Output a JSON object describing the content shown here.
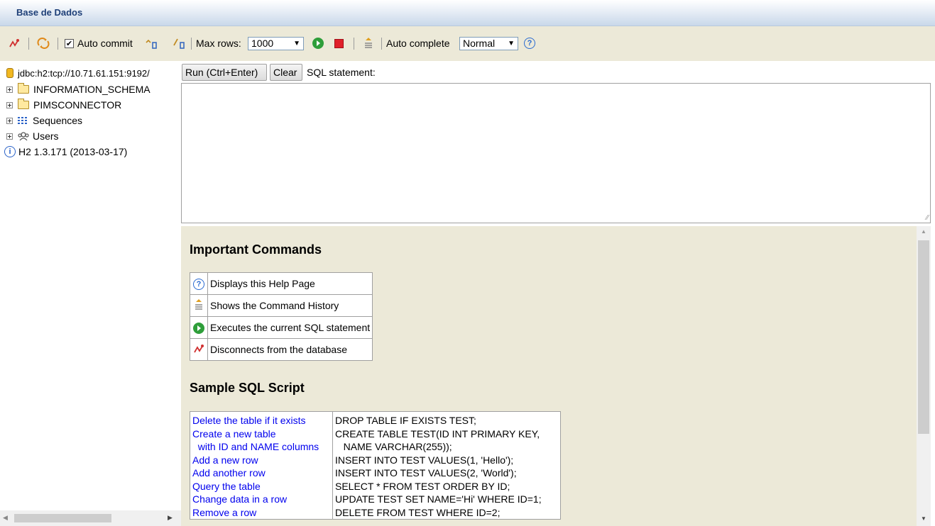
{
  "title": "Base de Dados",
  "toolbar": {
    "auto_commit_label": "Auto commit",
    "auto_commit_checked": true,
    "max_rows_label": "Max rows:",
    "max_rows_value": "1000",
    "auto_complete_label": "Auto complete",
    "auto_complete_value": "Normal"
  },
  "tree": {
    "connection": "jdbc:h2:tcp://10.71.61.151:9192/",
    "items": [
      "INFORMATION_SCHEMA",
      "PIMSCONNECTOR",
      "Sequences",
      "Users"
    ],
    "version": "H2 1.3.171 (2013-03-17)"
  },
  "query": {
    "run_label": "Run (Ctrl+Enter)",
    "clear_label": "Clear",
    "sql_label": "SQL statement:"
  },
  "help": {
    "commands_title": "Important Commands",
    "commands": [
      {
        "icon": "help-icon",
        "text": "Displays this Help Page"
      },
      {
        "icon": "history-icon",
        "text": "Shows the Command History"
      },
      {
        "icon": "run-icon",
        "text": "Executes the current SQL statement"
      },
      {
        "icon": "disconnect-icon",
        "text": "Disconnects from the database"
      }
    ],
    "script_title": "Sample SQL Script",
    "script": [
      {
        "desc": "Delete the table if it exists",
        "sql": "DROP TABLE IF EXISTS TEST;"
      },
      {
        "desc": "Create a new table",
        "sql": "CREATE TABLE TEST(ID INT PRIMARY KEY,"
      },
      {
        "desc": "  with ID and NAME columns",
        "sql": "   NAME VARCHAR(255));"
      },
      {
        "desc": "Add a new row",
        "sql": "INSERT INTO TEST VALUES(1, 'Hello');"
      },
      {
        "desc": "Add another row",
        "sql": "INSERT INTO TEST VALUES(2, 'World');"
      },
      {
        "desc": "Query the table",
        "sql": "SELECT * FROM TEST ORDER BY ID;"
      },
      {
        "desc": "Change data in a row",
        "sql": "UPDATE TEST SET NAME='Hi' WHERE ID=1;"
      },
      {
        "desc": "Remove a row",
        "sql": "DELETE FROM TEST WHERE ID=2;"
      }
    ]
  },
  "colors": {
    "title_text": "#1e3f78",
    "toolbar_bg": "#ece9d8",
    "link": "#0000ee",
    "run_green": "#2e9e3a",
    "stop_red": "#e0202a"
  }
}
